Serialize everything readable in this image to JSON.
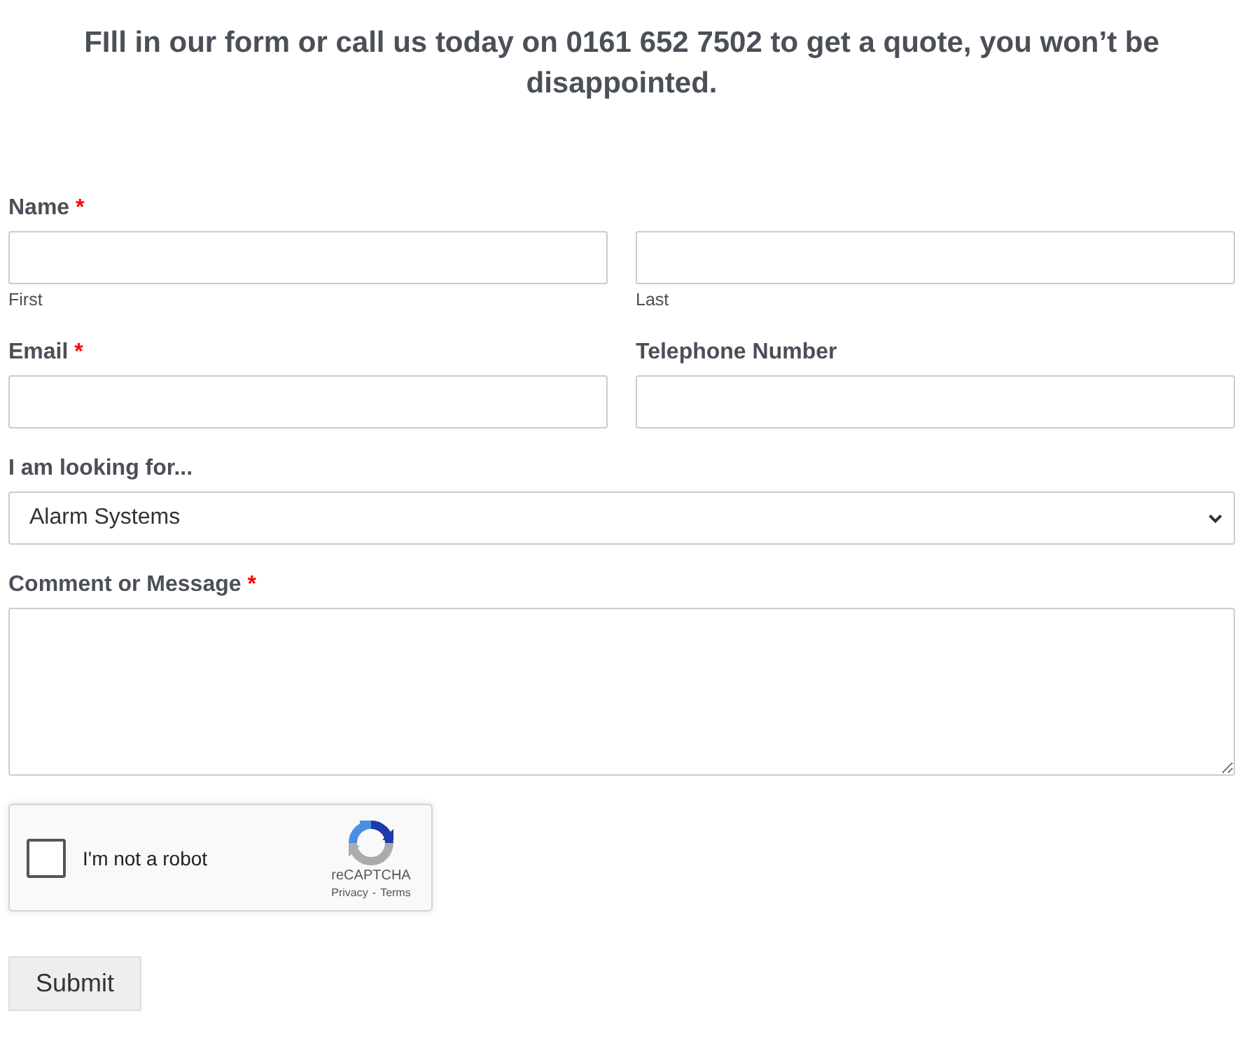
{
  "heading": "FIll in our form or call us today on 0161 652 7502 to get a quote, you won’t be disappointed.",
  "fields": [
    {
      "kind": "name",
      "label": "Name",
      "required_mark": "*",
      "parts": [
        {
          "sublabel": "First"
        },
        {
          "sublabel": "Last"
        }
      ]
    },
    {
      "kind": "pair",
      "items": [
        {
          "label": "Email",
          "required_mark": "*"
        },
        {
          "label": "Telephone Number"
        }
      ]
    },
    {
      "kind": "select",
      "label": "I am looking for...",
      "value": "Alarm Systems"
    },
    {
      "kind": "textarea",
      "label": "Comment or Message",
      "required_mark": "*"
    }
  ],
  "captcha": {
    "label": "I'm not a robot",
    "checked": false,
    "brand": "reCAPTCHA",
    "links": [
      "Privacy",
      "Terms"
    ],
    "separator": "-"
  },
  "submit": "Submit"
}
